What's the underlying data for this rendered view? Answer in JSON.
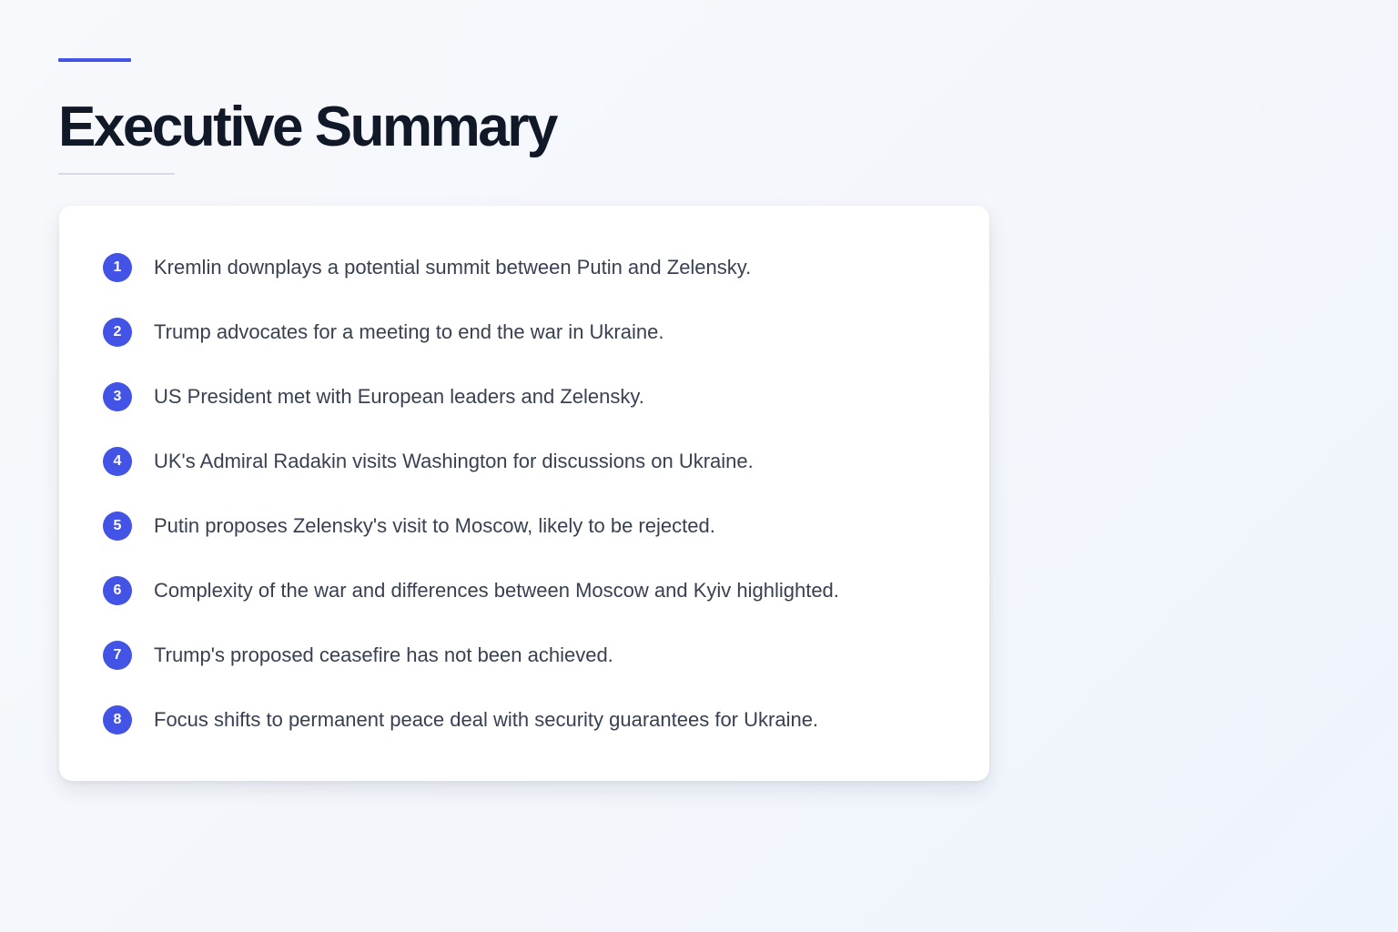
{
  "header": {
    "title": "Executive Summary",
    "accent_color": "#4353e6"
  },
  "summary": {
    "items": [
      {
        "number": "1",
        "text": "Kremlin downplays a potential summit between Putin and Zelensky."
      },
      {
        "number": "2",
        "text": "Trump advocates for a meeting to end the war in Ukraine."
      },
      {
        "number": "3",
        "text": "US President met with European leaders and Zelensky."
      },
      {
        "number": "4",
        "text": "UK's Admiral Radakin visits Washington for discussions on Ukraine."
      },
      {
        "number": "5",
        "text": "Putin proposes Zelensky's visit to Moscow, likely to be rejected."
      },
      {
        "number": "6",
        "text": "Complexity of the war and differences between Moscow and Kyiv highlighted."
      },
      {
        "number": "7",
        "text": "Trump's proposed ceasefire has not been achieved."
      },
      {
        "number": "8",
        "text": "Focus shifts to permanent peace deal with security guarantees for Ukraine."
      }
    ]
  }
}
